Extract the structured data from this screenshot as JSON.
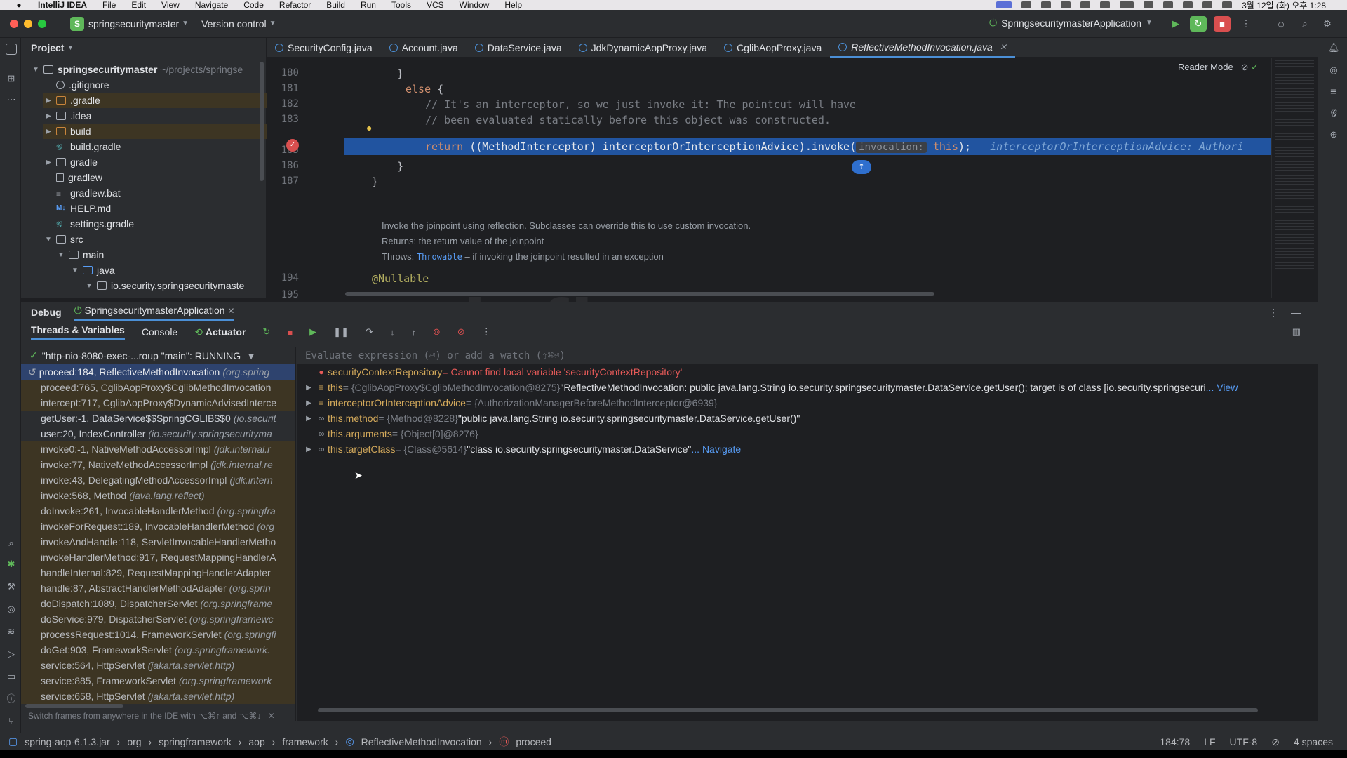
{
  "menubar": {
    "app": "IntelliJ IDEA",
    "menus": [
      "File",
      "Edit",
      "View",
      "Navigate",
      "Code",
      "Refactor",
      "Build",
      "Run",
      "Tools",
      "VCS",
      "Window",
      "Help"
    ],
    "clock": "3월 12일 (화) 오후 1:28"
  },
  "titlebar": {
    "project_badge": "S",
    "project": "springsecuritymaster",
    "version_control": "Version control",
    "run_config": "SpringsecuritymasterApplication"
  },
  "project_panel": {
    "title": "Project",
    "rows": [
      {
        "label": "springsecuritymaster",
        "suffix": "~/projects/springse"
      },
      {
        "label": ".gitignore"
      },
      {
        "label": ".gradle"
      },
      {
        "label": ".idea"
      },
      {
        "label": "build"
      },
      {
        "label": "build.gradle"
      },
      {
        "label": "gradle"
      },
      {
        "label": "gradlew"
      },
      {
        "label": "gradlew.bat"
      },
      {
        "label": "HELP.md"
      },
      {
        "label": "settings.gradle"
      },
      {
        "label": "src"
      },
      {
        "label": "main"
      },
      {
        "label": "java"
      },
      {
        "label": "io.security.springsecuritymaste"
      }
    ]
  },
  "tabs": [
    {
      "label": "SecurityConfig.java"
    },
    {
      "label": "Account.java"
    },
    {
      "label": "DataService.java"
    },
    {
      "label": "JdkDynamicAopProxy.java"
    },
    {
      "label": "CglibAopProxy.java"
    },
    {
      "label": "ReflectiveMethodInvocation.java"
    }
  ],
  "editor": {
    "reader_mode": "Reader Mode",
    "line_numbers": [
      "180",
      "181",
      "182",
      "183",
      "",
      "185",
      "186",
      "187",
      "194",
      "195"
    ],
    "lines": {
      "l180": "}",
      "l181_kw": "else",
      "l181_rest": " {",
      "l182": "// It's an interceptor, so we just invoke it: The pointcut will have",
      "l183": "// been evaluated statically before this object was constructed.",
      "l184_kw": "return",
      "l184_a": " ((MethodInterceptor) interceptorOrInterceptionAdvice).invoke(",
      "l184_hint": "invocation:",
      "l184_this": " this",
      "l184_end": ");",
      "l184_inline": "interceptorOrInterceptionAdvice: Authori",
      "l185": "}",
      "l186": "}",
      "l194": "@Nullable"
    },
    "doc": {
      "summary": "Invoke the joinpoint using reflection. Subclasses can override this to use custom invocation.",
      "returns": "Returns: the return value of the joinpoint",
      "throws_label": "Throws:",
      "throws_type": "Throwable",
      "throws_rest": " – if invoking the joinpoint resulted in an exception"
    }
  },
  "debug": {
    "title": "Debug",
    "session": "SpringsecuritymasterApplication",
    "tabs": [
      "Threads & Variables",
      "Console",
      "Actuator"
    ],
    "thread": "\"http-nio-8080-exec-...roup \"main\": RUNNING",
    "frames": [
      {
        "method": "proceed:184, ReflectiveMethodInvocation",
        "pkg": "(org.spring",
        "kind": "sel"
      },
      {
        "method": "proceed:765, CglibAopProxy$CglibMethodInvocation",
        "pkg": "",
        "kind": "lib"
      },
      {
        "method": "intercept:717, CglibAopProxy$DynamicAdvisedInterce",
        "pkg": "",
        "kind": "lib"
      },
      {
        "method": "getUser:-1, DataService$$SpringCGLIB$$0",
        "pkg": "(io.securit",
        "kind": "user"
      },
      {
        "method": "user:20, IndexController",
        "pkg": "(io.security.springsecurityma",
        "kind": "user"
      },
      {
        "method": "invoke0:-1, NativeMethodAccessorImpl",
        "pkg": "(jdk.internal.r",
        "kind": "lib"
      },
      {
        "method": "invoke:77, NativeMethodAccessorImpl",
        "pkg": "(jdk.internal.re",
        "kind": "lib"
      },
      {
        "method": "invoke:43, DelegatingMethodAccessorImpl",
        "pkg": "(jdk.intern",
        "kind": "lib"
      },
      {
        "method": "invoke:568, Method",
        "pkg": "(java.lang.reflect)",
        "kind": "lib"
      },
      {
        "method": "doInvoke:261, InvocableHandlerMethod",
        "pkg": "(org.springfra",
        "kind": "lib"
      },
      {
        "method": "invokeForRequest:189, InvocableHandlerMethod",
        "pkg": "(org",
        "kind": "lib"
      },
      {
        "method": "invokeAndHandle:118, ServletInvocableHandlerMetho",
        "pkg": "",
        "kind": "lib"
      },
      {
        "method": "invokeHandlerMethod:917, RequestMappingHandlerA",
        "pkg": "",
        "kind": "lib"
      },
      {
        "method": "handleInternal:829, RequestMappingHandlerAdapter",
        "pkg": "",
        "kind": "lib"
      },
      {
        "method": "handle:87, AbstractHandlerMethodAdapter",
        "pkg": "(org.sprin",
        "kind": "lib"
      },
      {
        "method": "doDispatch:1089, DispatcherServlet",
        "pkg": "(org.springframe",
        "kind": "lib"
      },
      {
        "method": "doService:979, DispatcherServlet",
        "pkg": "(org.springframewc",
        "kind": "lib"
      },
      {
        "method": "processRequest:1014, FrameworkServlet",
        "pkg": "(org.springfi",
        "kind": "lib"
      },
      {
        "method": "doGet:903, FrameworkServlet",
        "pkg": "(org.springframework.",
        "kind": "lib"
      },
      {
        "method": "service:564, HttpServlet",
        "pkg": "(jakarta.servlet.http)",
        "kind": "lib"
      },
      {
        "method": "service:885, FrameworkServlet",
        "pkg": "(org.springframework",
        "kind": "lib"
      },
      {
        "method": "service:658, HttpServlet",
        "pkg": "(jakarta.servlet.http)",
        "kind": "lib"
      }
    ],
    "frames_hint": "Switch frames from anywhere in the IDE with ⌥⌘↑ and ⌥⌘↓",
    "eval_placeholder": "Evaluate expression (⏎) or add a watch (⇧⌘⏎)",
    "vars": {
      "v1_name": "securityContextRepository",
      "v1_value": " = Cannot find local variable 'securityContextRepository'",
      "v2_name": "this",
      "v2_type": " = {CglibAopProxy$CglibMethodInvocation@8275} ",
      "v2_value": "\"ReflectiveMethodInvocation: public java.lang.String io.security.springsecuritymaster.DataService.getUser(); target is of class [io.security.springsecuri",
      "v2_link": "... View",
      "v3_name": "interceptorOrInterceptionAdvice",
      "v3_type": " = {AuthorizationManagerBeforeMethodInterceptor@6939}",
      "v4_name": "this.method",
      "v4_type": " = {Method@8228} ",
      "v4_value": "\"public java.lang.String io.security.springsecuritymaster.DataService.getUser()\"",
      "v5_name": "this.arguments",
      "v5_type": " = {Object[0]@8276}",
      "v6_name": "this.targetClass",
      "v6_type": " = {Class@5614} ",
      "v6_value": "\"class io.security.springsecuritymaster.DataService\"",
      "v6_link": " ... Navigate"
    }
  },
  "statusbar": {
    "crumbs": [
      "spring-aop-6.1.3.jar",
      "org",
      "springframework",
      "aop",
      "framework",
      "ReflectiveMethodInvocation",
      "proceed"
    ],
    "position": "184:78",
    "line_sep": "LF",
    "encoding": "UTF-8",
    "indent": "4 spaces"
  },
  "colors": {
    "accent": "#4b8fd6",
    "exec_line": "#2154a0",
    "error": "#e75a58",
    "var_name": "#d3a95b"
  }
}
